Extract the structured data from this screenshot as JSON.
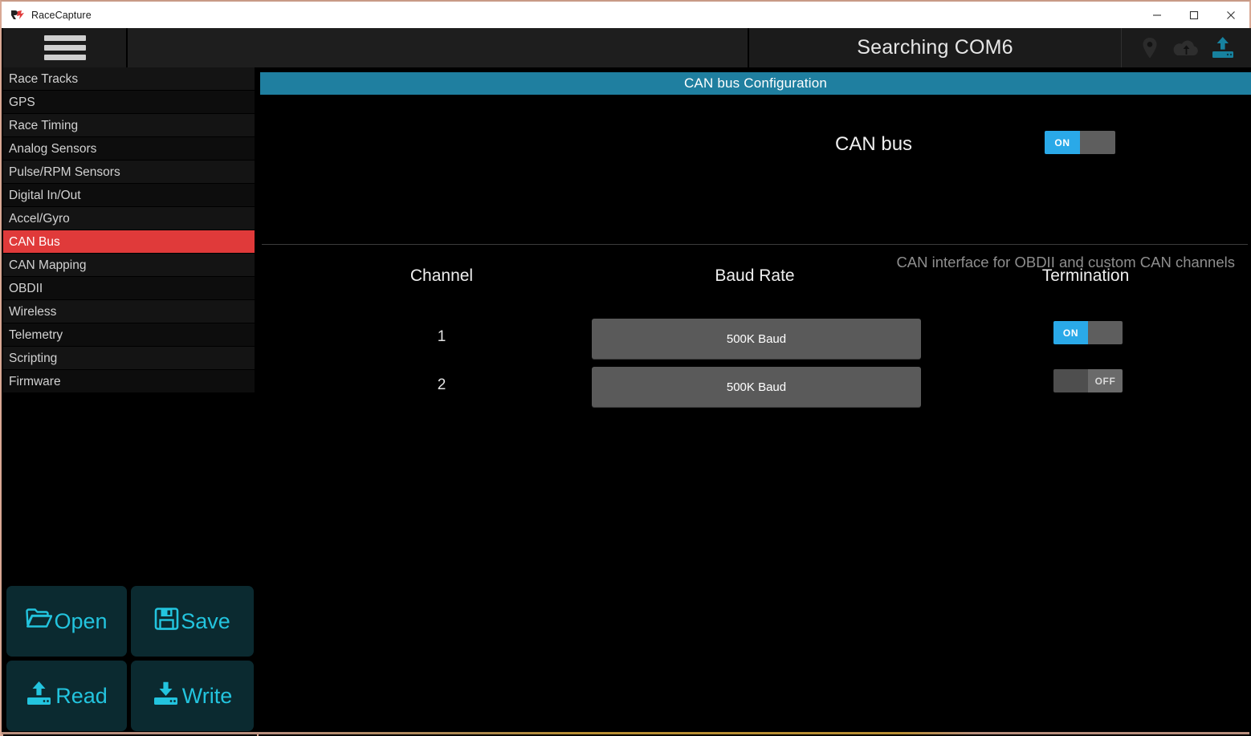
{
  "window": {
    "app_title": "RaceCapture",
    "logo_icon": "racecapture-logo-icon",
    "minimize_label": "—",
    "maximize_label": "☐",
    "close_label": "✕"
  },
  "header": {
    "menu_icon": "hamburger-menu-icon",
    "status_text": "Searching COM6",
    "icons": [
      {
        "name": "location-pin-icon",
        "color": "#2b2b2b"
      },
      {
        "name": "cloud-upload-icon",
        "color": "#2e2e2e"
      },
      {
        "name": "device-upload-icon",
        "color": "#17718a"
      }
    ]
  },
  "sidebar": {
    "items": [
      {
        "label": "Race Tracks",
        "active": false
      },
      {
        "label": "GPS",
        "active": false
      },
      {
        "label": "Race Timing",
        "active": false
      },
      {
        "label": "Analog Sensors",
        "active": false
      },
      {
        "label": "Pulse/RPM Sensors",
        "active": false
      },
      {
        "label": "Digital In/Out",
        "active": false
      },
      {
        "label": "Accel/Gyro",
        "active": false
      },
      {
        "label": "CAN Bus",
        "active": true
      },
      {
        "label": "CAN Mapping",
        "active": false
      },
      {
        "label": "OBDII",
        "active": false
      },
      {
        "label": "Wireless",
        "active": false
      },
      {
        "label": "Telemetry",
        "active": false
      },
      {
        "label": "Scripting",
        "active": false
      },
      {
        "label": "Firmware",
        "active": false
      }
    ],
    "active_color": "#e03a3a",
    "actions": [
      {
        "label": "Open",
        "icon": "folder-open-icon"
      },
      {
        "label": "Save",
        "icon": "floppy-disk-icon"
      },
      {
        "label": "Read",
        "icon": "device-read-icon"
      },
      {
        "label": "Write",
        "icon": "device-write-icon"
      }
    ],
    "action_color": "#23c4de"
  },
  "main": {
    "section_title": "CAN bus Configuration",
    "section_title_bg": "#1f7fa0",
    "canbus": {
      "label": "CAN bus",
      "toggle_state": "ON",
      "toggle_on_label": "ON",
      "toggle_off_label": "OFF",
      "description": "CAN interface for OBDII and custom CAN channels"
    },
    "table": {
      "headers": [
        "Channel",
        "Baud Rate",
        "Termination"
      ],
      "rows": [
        {
          "channel": "1",
          "baud_rate": "500K Baud",
          "termination": "ON",
          "termination_label": "ON"
        },
        {
          "channel": "2",
          "baud_rate": "500K Baud",
          "termination": "OFF",
          "termination_label": "OFF"
        }
      ]
    }
  },
  "theme": {
    "accent_blue": "#2aa9e8",
    "teal": "#23c4de",
    "header_blue": "#1f7fa0",
    "selection_red": "#e03a3a",
    "background": "#000000"
  }
}
